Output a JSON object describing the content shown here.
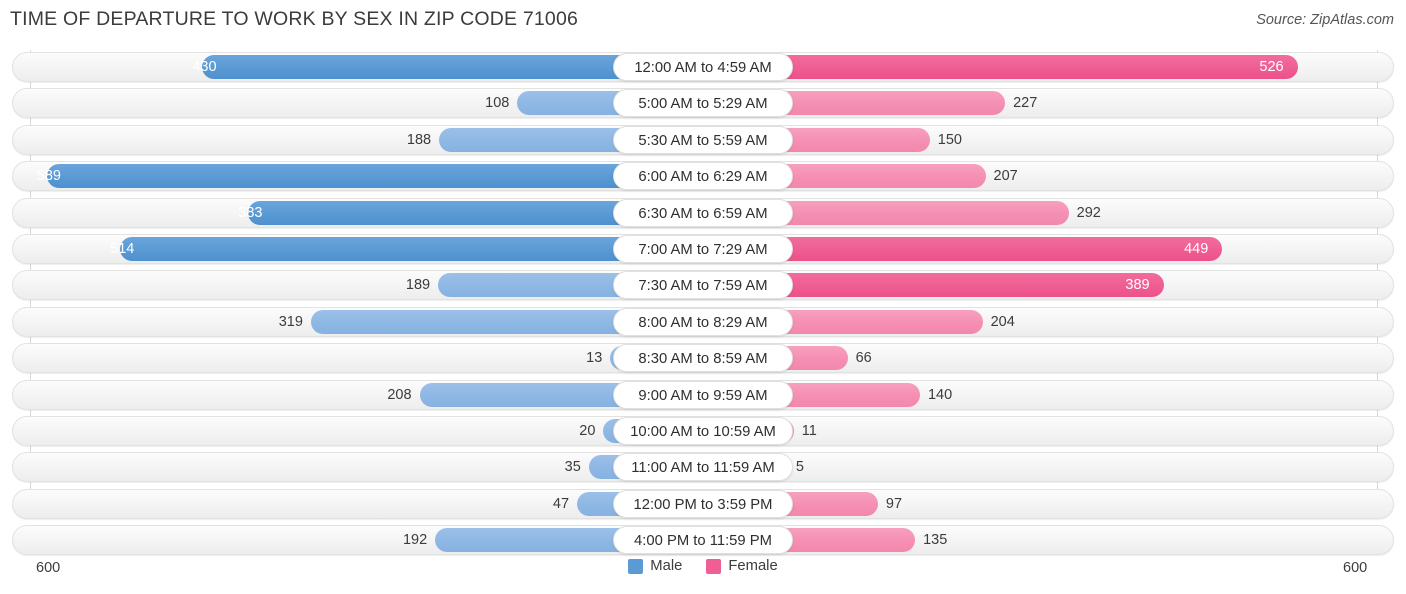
{
  "header": {
    "title": "TIME OF DEPARTURE TO WORK BY SEX IN ZIP CODE 71006",
    "source": "Source: ZipAtlas.com"
  },
  "axis": {
    "left_max_label": "600",
    "right_max_label": "600"
  },
  "legend": {
    "items": [
      {
        "label": "Male",
        "color": "#5b9bd5",
        "swatch_name": "male-swatch"
      },
      {
        "label": "Female",
        "color": "#ef5f93",
        "swatch_name": "female-swatch"
      }
    ]
  },
  "chart_data": {
    "type": "bar",
    "subtype": "diverging-bidirectional",
    "title": "TIME OF DEPARTURE TO WORK BY SEX IN ZIP CODE 71006",
    "xlabel": "",
    "ylabel": "",
    "xlim": [
      600,
      600
    ],
    "axis_max": 600,
    "grid": true,
    "legend_position": "bottom-center",
    "categories": [
      "12:00 AM to 4:59 AM",
      "5:00 AM to 5:29 AM",
      "5:30 AM to 5:59 AM",
      "6:00 AM to 6:29 AM",
      "6:30 AM to 6:59 AM",
      "7:00 AM to 7:29 AM",
      "7:30 AM to 7:59 AM",
      "8:00 AM to 8:29 AM",
      "8:30 AM to 8:59 AM",
      "9:00 AM to 9:59 AM",
      "10:00 AM to 10:59 AM",
      "11:00 AM to 11:59 AM",
      "12:00 PM to 3:59 PM",
      "4:00 PM to 11:59 PM"
    ],
    "series": [
      {
        "name": "Male",
        "direction": "left",
        "color": "#5b9bd5",
        "values": [
          430,
          108,
          188,
          589,
          383,
          514,
          189,
          319,
          13,
          208,
          20,
          35,
          47,
          192
        ]
      },
      {
        "name": "Female",
        "direction": "right",
        "color": "#ef5f93",
        "values": [
          526,
          227,
          150,
          207,
          292,
          449,
          389,
          204,
          66,
          140,
          11,
          5,
          97,
          135
        ]
      }
    ]
  }
}
